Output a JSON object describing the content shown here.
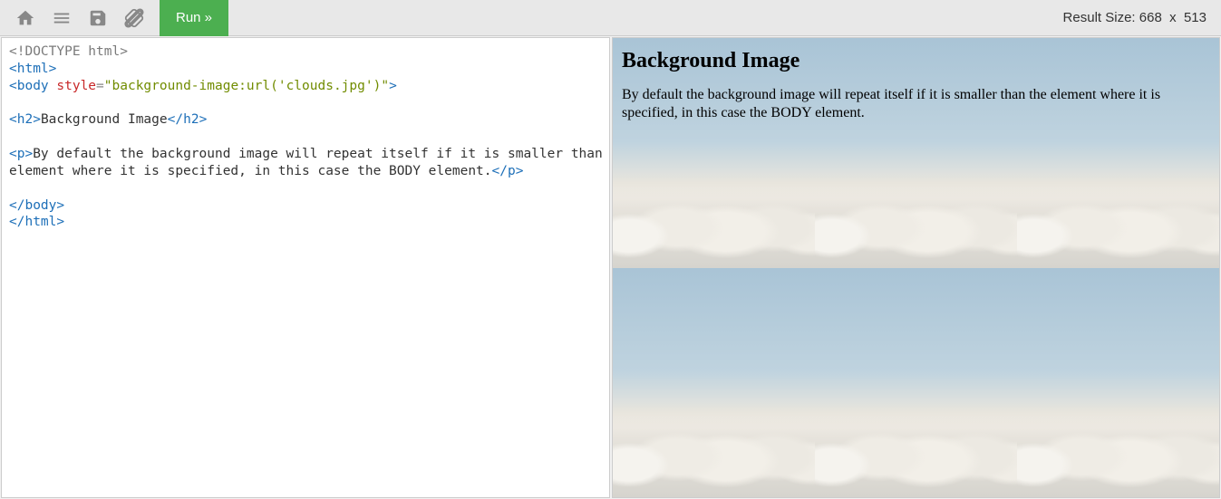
{
  "toolbar": {
    "run_label": "Run »",
    "result_label": "Result Size:",
    "result_w": "668",
    "result_h": "513"
  },
  "editor": {
    "doctype": "<!DOCTYPE html>",
    "html_open": "html",
    "body_open": "body",
    "attr_style": "style",
    "attr_style_val": "\"background-image:url('clouds.jpg')\"",
    "h2_tag": "h2",
    "h2_text": "Background Image",
    "p_tag": "p",
    "p_text1": "By default the background image will repeat itself if it is smaller than the ",
    "p_text2": "element where it is specified, in this case the BODY element.",
    "body_close": "/body",
    "html_close": "/html"
  },
  "result": {
    "heading": "Background Image",
    "paragraph": "By default the background image will repeat itself if it is smaller than the element where it is specified, in this case the BODY element."
  }
}
